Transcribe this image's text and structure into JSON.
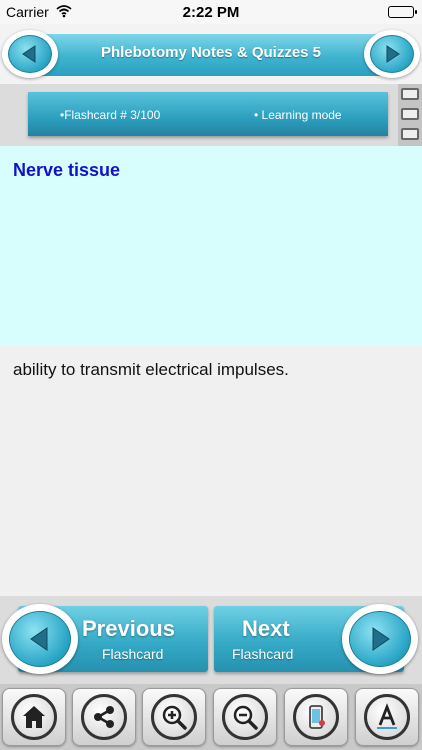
{
  "status_bar": {
    "carrier": "Carrier",
    "time": "2:22 PM"
  },
  "header": {
    "title": "Phlebotomy Notes & Quizzes 5",
    "prev_icon": "left-arrow-icon",
    "next_icon": "right-arrow-icon"
  },
  "info_bar": {
    "flashcard_label": "•Flashcard #  3/100",
    "mode_label": "• Learning mode"
  },
  "card": {
    "question": "Nerve tissue",
    "answer": "ability to transmit electrical impulses."
  },
  "nav": {
    "previous": {
      "title": "Previous",
      "subtitle": "Flashcard"
    },
    "next": {
      "title": "Next",
      "subtitle": "Flashcard"
    }
  },
  "toolbar": {
    "items": [
      "home-icon",
      "share-icon",
      "zoom-in-icon",
      "zoom-out-icon",
      "phone-settings-icon",
      "font-icon"
    ]
  },
  "colors": {
    "accent": "#2aa6c6",
    "question_bg": "#d8fdfd",
    "question_text": "#1212c8"
  }
}
